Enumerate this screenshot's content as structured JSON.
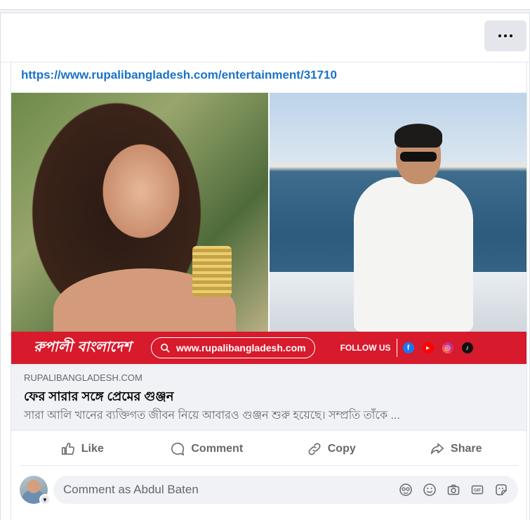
{
  "post": {
    "more_label": "More options",
    "link_url": "https://www.rupalibangladesh.com/entertainment/31710",
    "banner": {
      "brand": "রুপালী বাংলাদেশ",
      "url": "www.rupalibangladesh.com",
      "follow": "FOLLOW US"
    },
    "preview": {
      "domain": "RUPALIBANGLADESH.COM",
      "title": "ফের সারার সঙ্গে প্রেমের গুঞ্জন",
      "description": "সারা আলি খানের ব্যক্তিগত জীবন নিয়ে আবারও গুঞ্জন শুরু হয়েছে। সম্প্রতি তাঁকে ..."
    },
    "actions": {
      "like": "Like",
      "comment": "Comment",
      "copy": "Copy",
      "share": "Share"
    },
    "comment": {
      "placeholder": "Comment as Abdul Baten"
    }
  },
  "icons": {
    "more": "ellipsis-icon",
    "info": "info-icon",
    "like": "thumbs-up-icon",
    "comment": "speech-bubble-icon",
    "copy": "link-icon",
    "share": "share-arrow-icon",
    "comment_tools": [
      "avatar-sticker-icon",
      "emoji-icon",
      "camera-icon",
      "gif-icon",
      "sticker-icon"
    ]
  },
  "colors": {
    "link": "#1a73c8",
    "banner": "#d71a2c",
    "muted": "#65676b"
  }
}
